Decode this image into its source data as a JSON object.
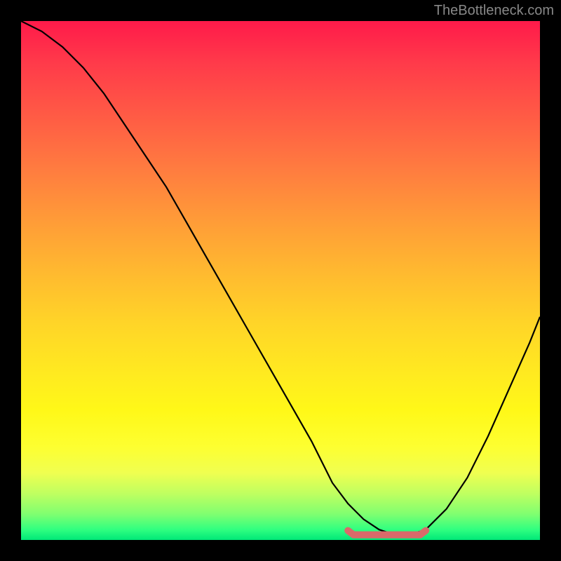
{
  "attribution": "TheBottleneck.com",
  "chart_data": {
    "type": "line",
    "title": "",
    "xlabel": "",
    "ylabel": "",
    "xlim": [
      0,
      100
    ],
    "ylim": [
      0,
      100
    ],
    "series": [
      {
        "name": "bottleneck-curve",
        "x": [
          0,
          4,
          8,
          12,
          16,
          20,
          24,
          28,
          32,
          36,
          40,
          44,
          48,
          52,
          56,
          58,
          60,
          63,
          66,
          69,
          72,
          75,
          78,
          82,
          86,
          90,
          94,
          98,
          100
        ],
        "values": [
          100,
          98,
          95,
          91,
          86,
          80,
          74,
          68,
          61,
          54,
          47,
          40,
          33,
          26,
          19,
          15,
          11,
          7,
          4,
          2,
          1,
          1,
          2,
          6,
          12,
          20,
          29,
          38,
          43
        ]
      }
    ],
    "minimum_region": {
      "x_start": 63,
      "x_end": 78,
      "y": 1
    },
    "gradient_description": "vertical red-to-green (bottleneck severity)",
    "colors": {
      "curve": "#000000",
      "marker": "#d96a6a",
      "background_top": "#ff1a4a",
      "background_bottom": "#00e878",
      "frame": "#000000"
    }
  }
}
